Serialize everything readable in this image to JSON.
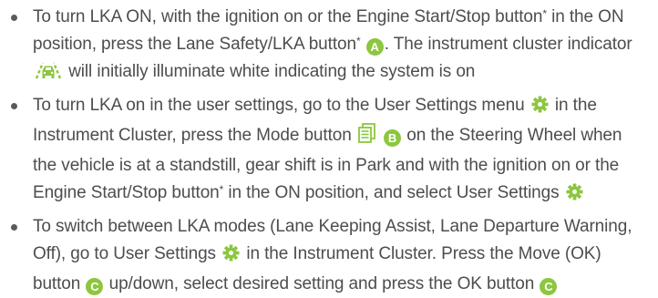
{
  "colors": {
    "accent_green": "#8dc63f",
    "text": "#4d4d4d"
  },
  "icons": {
    "gear": "gear-icon",
    "lka_indicator": "lane-keeping-car-icon",
    "mode_button": "mode-menu-icon"
  },
  "bullets": [
    {
      "t1": "To turn LKA ON, with the ignition on or the Engine Start/Stop button",
      "ast1": "*",
      "t2": " in the ON position, press the Lane Safety/LKA button",
      "ast2": "*",
      "badge": "A",
      "t3": ". The instrument cluster indicator",
      "t4": "will initially illuminate white indicating the system is on"
    },
    {
      "t1": "To turn LKA on in the user settings, go to the User Settings menu",
      "t2": " in the Instrument Cluster, press the Mode button",
      "badge": "B",
      "t3": " on the Steering Wheel when the vehicle is at a standstill, gear shift is in Park and with the ignition on or the Engine Start/Stop button",
      "ast": "*",
      "t4": " in the ON position, and select User Settings"
    },
    {
      "t1": "To switch between LKA modes (Lane Keeping Assist, Lane Departure Warning, Off), go to User Settings",
      "t2": " in the Instrument Cluster. Press the Move (OK) button",
      "badge1": "C",
      "t3": " up/down, select desired setting and press the OK button",
      "badge2": "C"
    }
  ]
}
